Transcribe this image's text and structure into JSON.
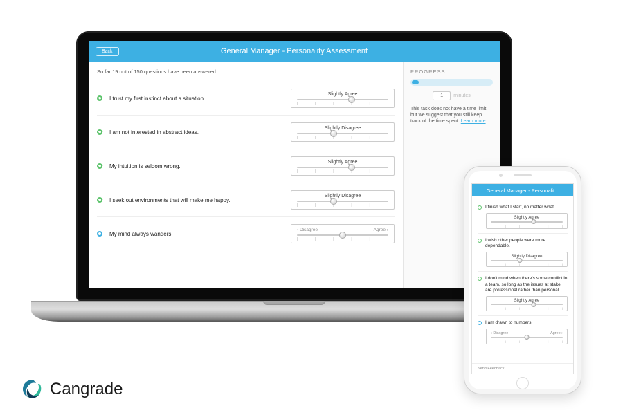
{
  "brand": {
    "name": "Cangrade"
  },
  "colors": {
    "accent": "#3db0e3",
    "done": "#5cc36b"
  },
  "laptop": {
    "header": {
      "back": "Back",
      "title": "General Manager - Personality Assessment"
    },
    "progress_text": "So far 19 out of 150 questions have been answered.",
    "questions": [
      {
        "text": "I trust my first instinct about a situation.",
        "value_label": "Slightly Agree",
        "thumb_pct": 60,
        "state": "done"
      },
      {
        "text": "I am not interested in abstract ideas.",
        "value_label": "Slightly Disagree",
        "thumb_pct": 40,
        "state": "done"
      },
      {
        "text": "My intuition is seldom wrong.",
        "value_label": "Slightly Agree",
        "thumb_pct": 60,
        "state": "done"
      },
      {
        "text": "I seek out environments that will make me happy.",
        "value_label": "Slightly Disagree",
        "thumb_pct": 40,
        "state": "done"
      },
      {
        "text": "My mind always wanders.",
        "value_label": "",
        "thumb_pct": 50,
        "state": "active",
        "nav_left": "‹ Disagree",
        "nav_right": "Agree ›"
      }
    ],
    "sidebar": {
      "heading": "PROGRESS:",
      "time_value": "1",
      "time_unit": "minutes",
      "note_pre": "This task does not have a time limit, but we suggest that you still keep track of the time spent. ",
      "note_link": "Learn more"
    }
  },
  "phone": {
    "title": "General Manager - Personalit...",
    "questions": [
      {
        "text": "I finish what I start, no matter what.",
        "value_label": "Slightly Agree",
        "thumb_pct": 60,
        "state": "done"
      },
      {
        "text": "I wish other people were more dependable.",
        "value_label": "Slightly Disagree",
        "thumb_pct": 40,
        "state": "done"
      },
      {
        "text": "I don't mind when there's some conflict in a team, so long as the issues at stake are professional rather than personal.",
        "value_label": "Slightly Agree",
        "thumb_pct": 60,
        "state": "done"
      },
      {
        "text": "I am drawn to numbers.",
        "value_label": "",
        "thumb_pct": 50,
        "state": "active",
        "nav_left": "‹ Disagree",
        "nav_right": "Agree ›"
      }
    ],
    "footer": "Send Feedback"
  },
  "ticks": [
    "|",
    "|",
    "|",
    "|",
    "|",
    "|"
  ]
}
